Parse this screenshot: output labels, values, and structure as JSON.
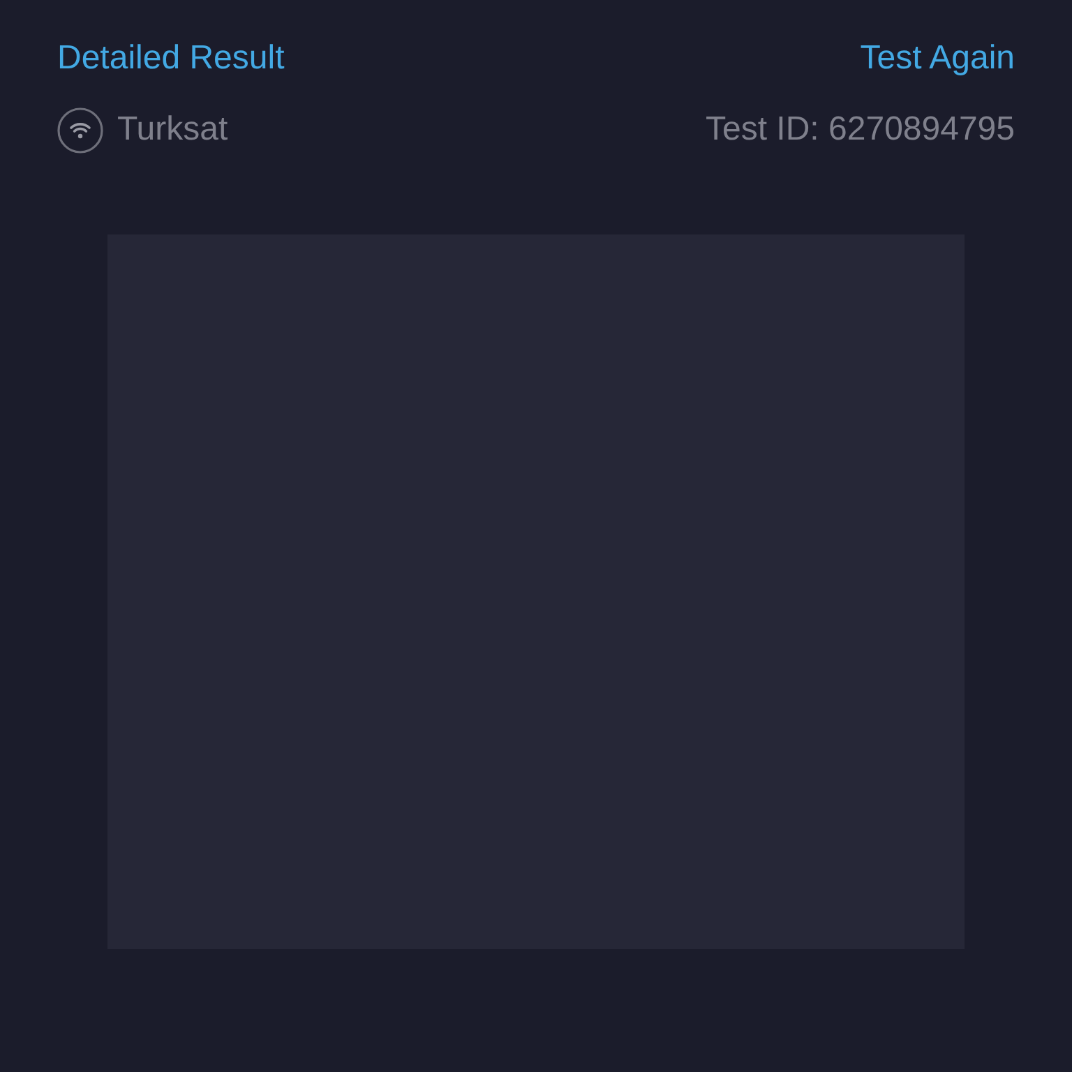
{
  "header": {
    "title": "Detailed Result",
    "action": "Test Again"
  },
  "info": {
    "provider": "Turksat",
    "test_id": "Test ID: 6270894795"
  }
}
